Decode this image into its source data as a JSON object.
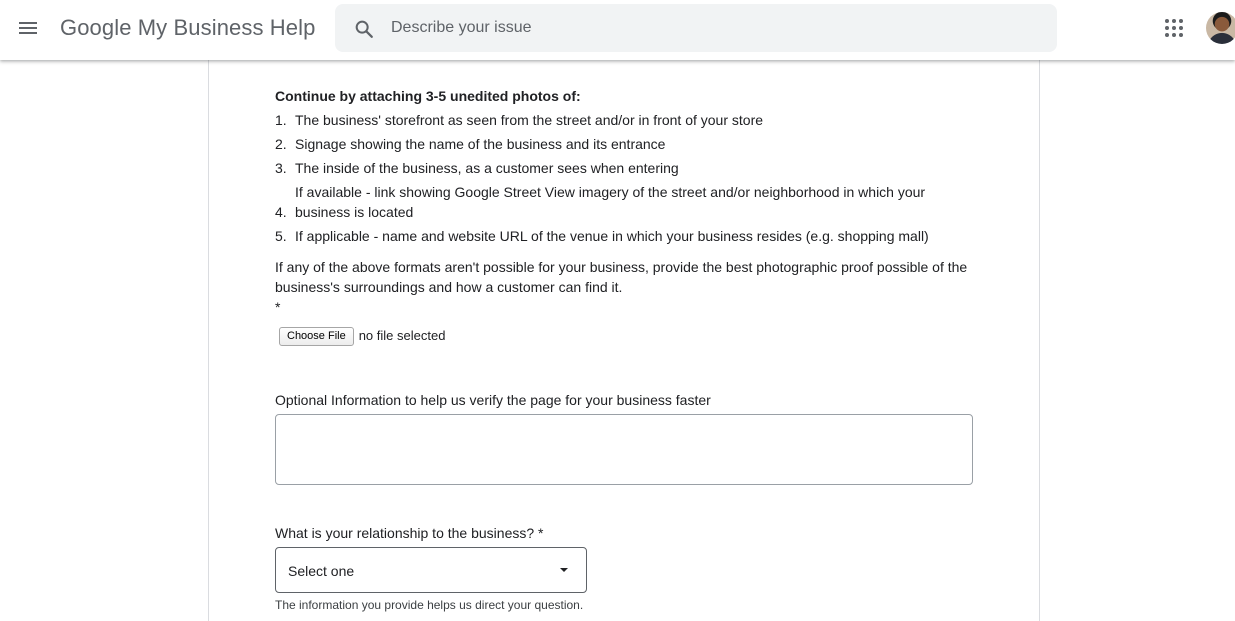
{
  "header": {
    "app_title": "Google My Business Help",
    "search_placeholder": "Describe your issue",
    "icons": [
      "menu-icon",
      "search-icon",
      "apps-grid-icon",
      "user-avatar"
    ]
  },
  "form": {
    "intro": "Continue by attaching 3-5 unedited photos of:",
    "steps": [
      {
        "num": "1.",
        "text": "The business' storefront as seen from the street and/or in front of your store"
      },
      {
        "num": "2.",
        "text": "Signage showing the name of the business and its entrance"
      },
      {
        "num": "3.",
        "text": "The inside of the business, as a customer sees when entering"
      },
      {
        "num": "4.",
        "text": "If available - link showing Google Street View imagery of the street and/or neighborhood in which your business is located"
      },
      {
        "num": "5.",
        "text": "If applicable - name and website URL of the venue in which your business resides (e.g. shopping mall)"
      }
    ],
    "note": "If any of the above formats aren't possible for your business, provide the best photographic proof possible of the business's surroundings and how a customer can find it.",
    "required_marker": "*",
    "file_button": "Choose File",
    "file_status": "no file selected",
    "optional_label": "Optional Information to help us verify the page for your business faster",
    "optional_value": "",
    "relationship_label": "What is your relationship to the business? *",
    "relationship_selected": "Select one",
    "help_text": "The information you provide helps us direct your question."
  },
  "colors": {
    "title_gray": "#5f6368",
    "search_bg": "#f1f3f4",
    "text": "#202124",
    "border": "#dadce0"
  }
}
